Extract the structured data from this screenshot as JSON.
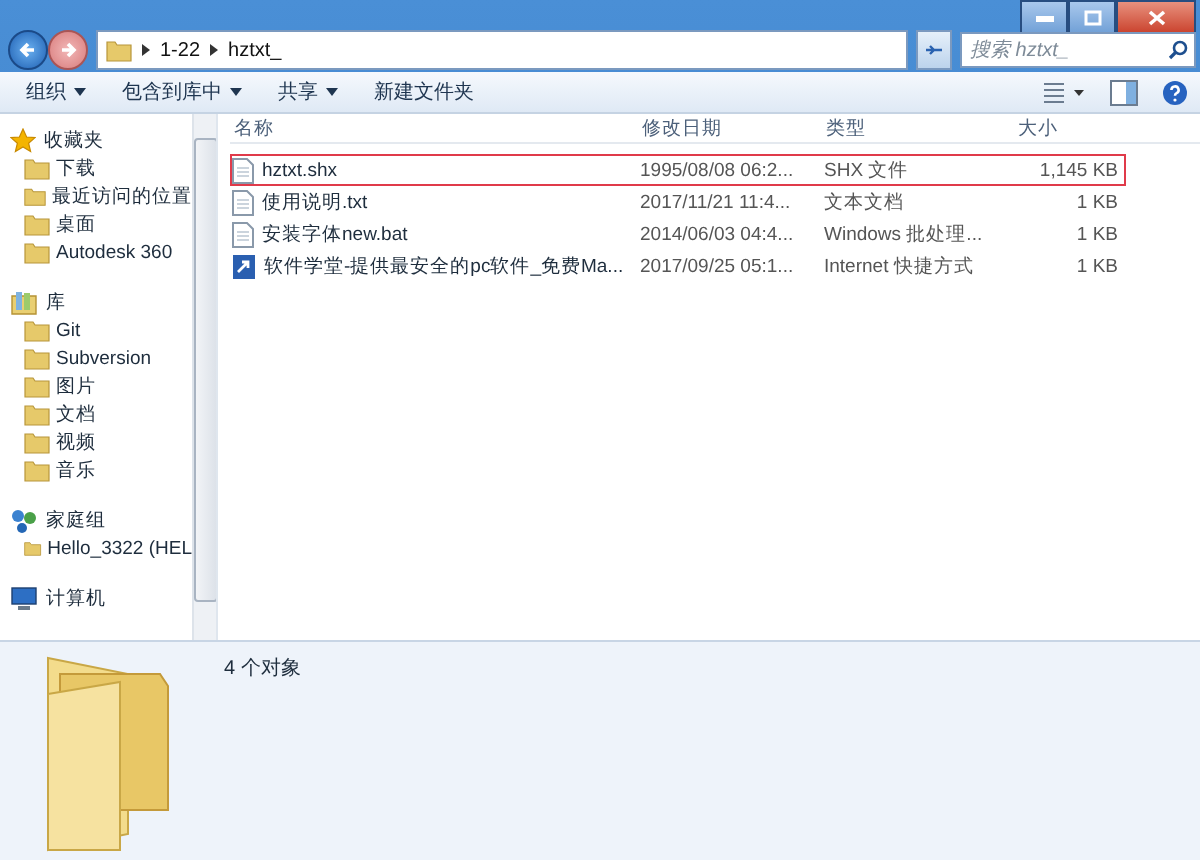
{
  "address_bar": {
    "segments": [
      "1-22",
      "hztxt_"
    ]
  },
  "search": {
    "placeholder": "搜索 hztxt_"
  },
  "toolbar": {
    "items": [
      {
        "label": "组织",
        "dropdown": true
      },
      {
        "label": "包含到库中",
        "dropdown": true
      },
      {
        "label": "共享",
        "dropdown": true
      },
      {
        "label": "新建文件夹",
        "dropdown": false
      }
    ]
  },
  "sidebar": {
    "groups": [
      {
        "label": "收藏夹",
        "children": [
          {
            "label": "下载"
          },
          {
            "label": "最近访问的位置"
          },
          {
            "label": "桌面"
          },
          {
            "label": "Autodesk 360"
          }
        ]
      },
      {
        "label": "库",
        "children": [
          {
            "label": "Git"
          },
          {
            "label": "Subversion"
          },
          {
            "label": "图片"
          },
          {
            "label": "文档"
          },
          {
            "label": "视频"
          },
          {
            "label": "音乐"
          }
        ]
      },
      {
        "label": "家庭组",
        "children": [
          {
            "label": "Hello_3322 (HEL"
          }
        ]
      },
      {
        "label": "计算机"
      }
    ]
  },
  "table": {
    "columns": [
      "名称",
      "修改日期",
      "类型",
      "大小"
    ],
    "rows": [
      {
        "name": "hztxt.shx",
        "date": "1995/08/08 06:2...",
        "type": "SHX 文件",
        "size": "1,145 KB",
        "highlighted": true
      },
      {
        "name": "使用说明.txt",
        "date": "2017/11/21 11:4...",
        "type": "文本文档",
        "size": "1 KB",
        "highlighted": false
      },
      {
        "name": "安装字体new.bat",
        "date": "2014/06/03 04:4...",
        "type": "Windows 批处理...",
        "size": "1 KB",
        "highlighted": false
      },
      {
        "name": "软件学堂-提供最安全的pc软件_免费Ma...",
        "date": "2017/09/25 05:1...",
        "type": "Internet 快捷方式",
        "size": "1 KB",
        "highlighted": false
      }
    ]
  },
  "details_pane": {
    "status": "4 个对象"
  }
}
